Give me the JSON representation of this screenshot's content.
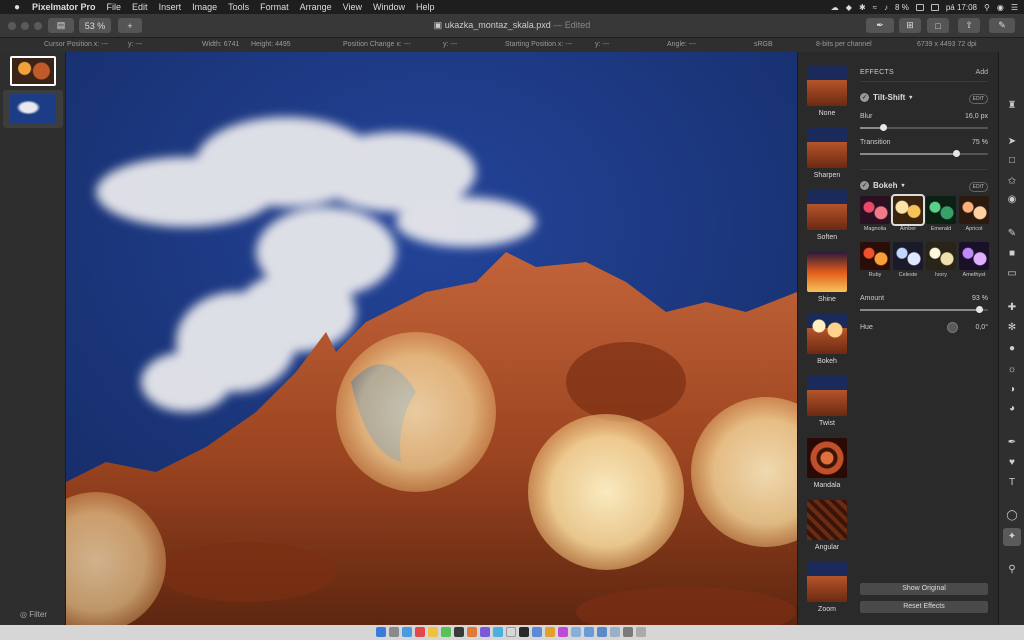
{
  "menubar": {
    "app_name": "Pixelmator Pro",
    "items": [
      "File",
      "Edit",
      "Insert",
      "Image",
      "Tools",
      "Format",
      "Arrange",
      "View",
      "Window",
      "Help"
    ],
    "battery": "8 %",
    "clock": "pá 17:08"
  },
  "toolbar": {
    "zoom": "53 %",
    "add_label": "+",
    "doc_name": "ukazka_montaz_skala.pxd",
    "doc_status": "— Edited"
  },
  "infobar": {
    "cursor": "Cursor Position x: ---",
    "cursor_y": "y: ---",
    "width": "Width: 6741",
    "height": "Height: 4495",
    "pos_change": "Position Change x: ---",
    "pos_change_y": "y: ---",
    "start_pos": "Starting Position x: ---",
    "start_pos_y": "y: ---",
    "angle": "Angle: ---",
    "colorspace": "sRGB",
    "bits": "8-bits per channel",
    "dims": "6739 x 4493 72 dpi"
  },
  "layers": {
    "filter_label": "Filter"
  },
  "presets": [
    {
      "label": "None"
    },
    {
      "label": "Sharpen"
    },
    {
      "label": "Soften"
    },
    {
      "label": "Shine"
    },
    {
      "label": "Bokeh"
    },
    {
      "label": "Twist"
    },
    {
      "label": "Mandala"
    },
    {
      "label": "Angular"
    },
    {
      "label": "Zoom"
    }
  ],
  "effects": {
    "header": "EFFECTS",
    "add_label": "Add",
    "edit_label": "EDIT",
    "tilt_shift": {
      "title": "Tilt-Shift",
      "blur_label": "Blur",
      "blur_value": "16,0 px",
      "blur_fraction": 0.18,
      "transition_label": "Transition",
      "transition_value": "75 %",
      "transition_fraction": 0.75
    },
    "bokeh": {
      "title": "Bokeh",
      "styles": [
        "Magnolia",
        "Amber",
        "Emerald",
        "Apricot",
        "Ruby",
        "Celeste",
        "Ivory",
        "Amethyst"
      ],
      "selected": "Amber",
      "amount_label": "Amount",
      "amount_value": "93 %",
      "amount_fraction": 0.93,
      "hue_label": "Hue",
      "hue_value": "0,0°"
    },
    "show_original": "Show Original",
    "reset_effects": "Reset Effects"
  },
  "colors": {
    "sky": "#1b3679",
    "rock": "#b5542a",
    "bokeh": "#fbe3a6",
    "panel": "#2a2a2a"
  }
}
